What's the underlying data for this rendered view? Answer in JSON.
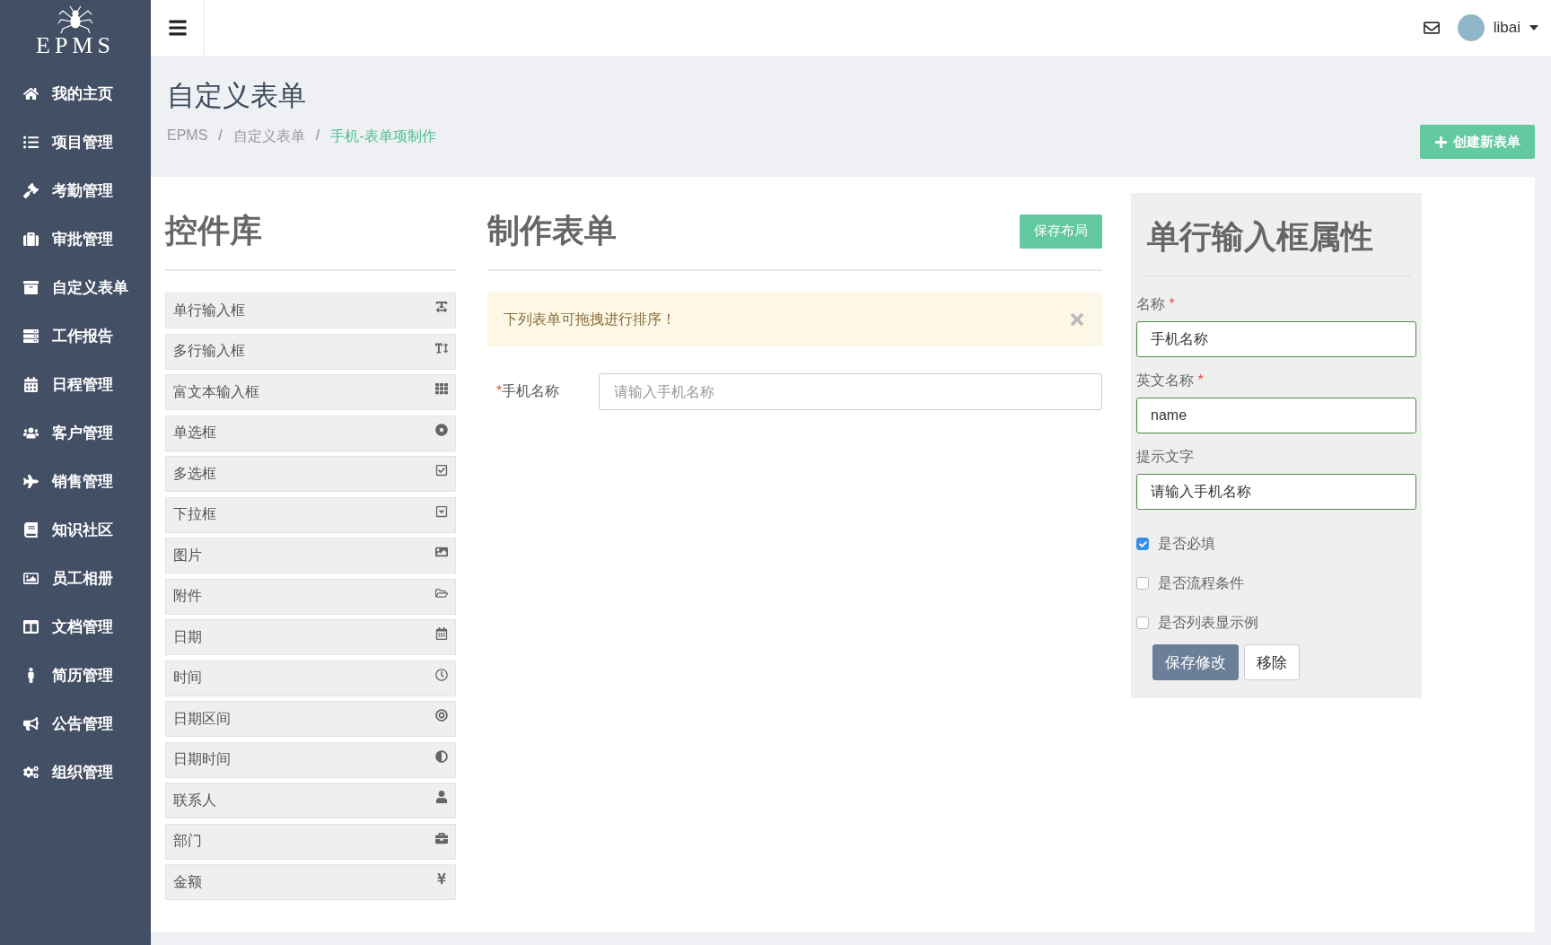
{
  "sidebar": {
    "logo": "EPMS",
    "items": [
      {
        "label": "我的主页"
      },
      {
        "label": "项目管理"
      },
      {
        "label": "考勤管理"
      },
      {
        "label": "审批管理"
      },
      {
        "label": "自定义表单"
      },
      {
        "label": "工作报告"
      },
      {
        "label": "日程管理"
      },
      {
        "label": "客户管理"
      },
      {
        "label": "销售管理"
      },
      {
        "label": "知识社区"
      },
      {
        "label": "员工相册"
      },
      {
        "label": "文档管理"
      },
      {
        "label": "简历管理"
      },
      {
        "label": "公告管理"
      },
      {
        "label": "组织管理"
      }
    ]
  },
  "topbar": {
    "user": "libai"
  },
  "header": {
    "title": "自定义表单",
    "breadcrumb": [
      {
        "label": "EPMS",
        "selected": false
      },
      {
        "label": "自定义表单",
        "selected": false
      },
      {
        "label": "手机-表单项制作",
        "selected": true
      }
    ],
    "separator": "/",
    "action": "创建新表单"
  },
  "library": {
    "title": "控件库",
    "items": [
      {
        "label": "单行输入框"
      },
      {
        "label": "多行输入框"
      },
      {
        "label": "富文本输入框"
      },
      {
        "label": "单选框"
      },
      {
        "label": "多选框"
      },
      {
        "label": "下拉框"
      },
      {
        "label": "图片"
      },
      {
        "label": "附件"
      },
      {
        "label": "日期"
      },
      {
        "label": "时间"
      },
      {
        "label": "日期区间"
      },
      {
        "label": "日期时间"
      },
      {
        "label": "联系人"
      },
      {
        "label": "部门"
      },
      {
        "label": "金额"
      }
    ]
  },
  "builder": {
    "title": "制作表单",
    "save": "保存布局",
    "alert": "下列表单可拖拽进行排序！",
    "fields": [
      {
        "marker": "*",
        "label": "手机名称",
        "placeholder": "请输入手机名称"
      }
    ]
  },
  "properties": {
    "title": "单行输入框属性",
    "fields": [
      {
        "label": "名称",
        "marker": "*",
        "value": "手机名称"
      },
      {
        "label": "英文名称",
        "marker": "*",
        "value": "name"
      },
      {
        "label": "提示文字",
        "value": "请输入手机名称"
      }
    ],
    "options": [
      {
        "label": "是否必填",
        "checked": true
      },
      {
        "label": "是否流程条件",
        "checked": false
      },
      {
        "label": "是否列表显示例",
        "checked": false
      }
    ],
    "buttons": [
      {
        "label": "保存修改",
        "kind": "primary"
      },
      {
        "label": "移除",
        "kind": "default"
      }
    ]
  }
}
